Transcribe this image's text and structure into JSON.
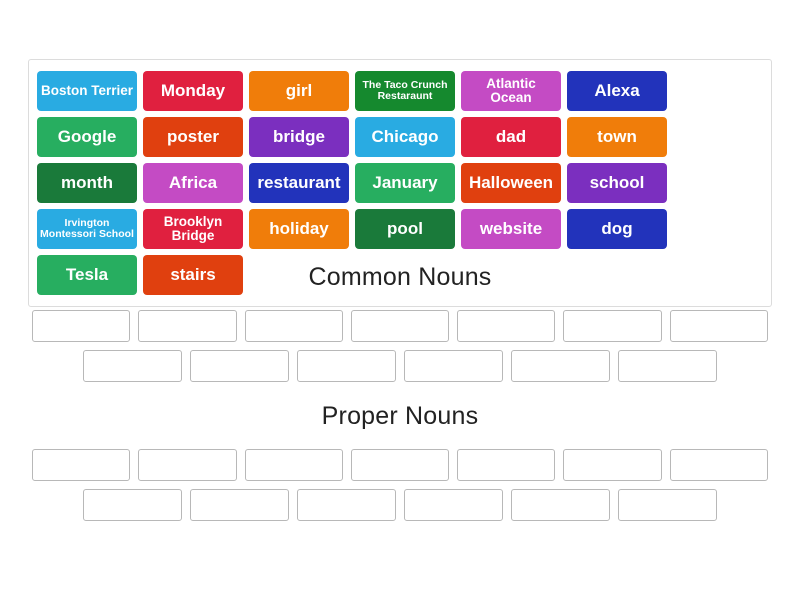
{
  "activity": {
    "type": "group-sort",
    "tile_bank_label": "word tile bank"
  },
  "tiles": [
    {
      "label": "Boston Terrier",
      "color": "#29abe2",
      "lines": 2
    },
    {
      "label": "Monday",
      "color": "#e0203f",
      "lines": 1
    },
    {
      "label": "girl",
      "color": "#f07d0a",
      "lines": 1
    },
    {
      "label": "The Taco Crunch Restaraunt",
      "color": "#15892e",
      "lines": 3
    },
    {
      "label": "Atlantic Ocean",
      "color": "#c44bc4",
      "lines": 2
    },
    {
      "label": "Alexa",
      "color": "#2233bb",
      "lines": 1
    },
    {
      "label": "Google",
      "color": "#27ae60",
      "lines": 1
    },
    {
      "label": "poster",
      "color": "#e0400f",
      "lines": 1
    },
    {
      "label": "bridge",
      "color": "#7b2fbf",
      "lines": 1
    },
    {
      "label": "Chicago",
      "color": "#29abe2",
      "lines": 1
    },
    {
      "label": "dad",
      "color": "#e0203f",
      "lines": 1
    },
    {
      "label": "town",
      "color": "#f07d0a",
      "lines": 1
    },
    {
      "label": "month",
      "color": "#1a7a3a",
      "lines": 1
    },
    {
      "label": "Africa",
      "color": "#c44bc4",
      "lines": 1
    },
    {
      "label": "restaurant",
      "color": "#2233bb",
      "lines": 1
    },
    {
      "label": "January",
      "color": "#27ae60",
      "lines": 1
    },
    {
      "label": "Halloween",
      "color": "#e0400f",
      "lines": 1
    },
    {
      "label": "school",
      "color": "#7b2fbf",
      "lines": 1
    },
    {
      "label": "Irvington Montessori School",
      "color": "#29abe2",
      "lines": 3
    },
    {
      "label": "Brooklyn Bridge",
      "color": "#e0203f",
      "lines": 2
    },
    {
      "label": "holiday",
      "color": "#f07d0a",
      "lines": 1
    },
    {
      "label": "pool",
      "color": "#1a7a3a",
      "lines": 1
    },
    {
      "label": "website",
      "color": "#c44bc4",
      "lines": 1
    },
    {
      "label": "dog",
      "color": "#2233bb",
      "lines": 1
    },
    {
      "label": "Tesla",
      "color": "#27ae60",
      "lines": 1
    },
    {
      "label": "stairs",
      "color": "#e0400f",
      "lines": 1
    }
  ],
  "categories": [
    {
      "title": "Common Nouns",
      "slot_rows": [
        7,
        6
      ],
      "slots_filled": []
    },
    {
      "title": "Proper Nouns",
      "slot_rows": [
        7,
        6
      ],
      "slots_filled": []
    }
  ],
  "colors": {
    "tile_bank_border": "#dcdcdc",
    "slot_border": "#b8b8b8",
    "page_background": "#ffffff",
    "title_text": "#222222",
    "tile_text": "#ffffff"
  }
}
